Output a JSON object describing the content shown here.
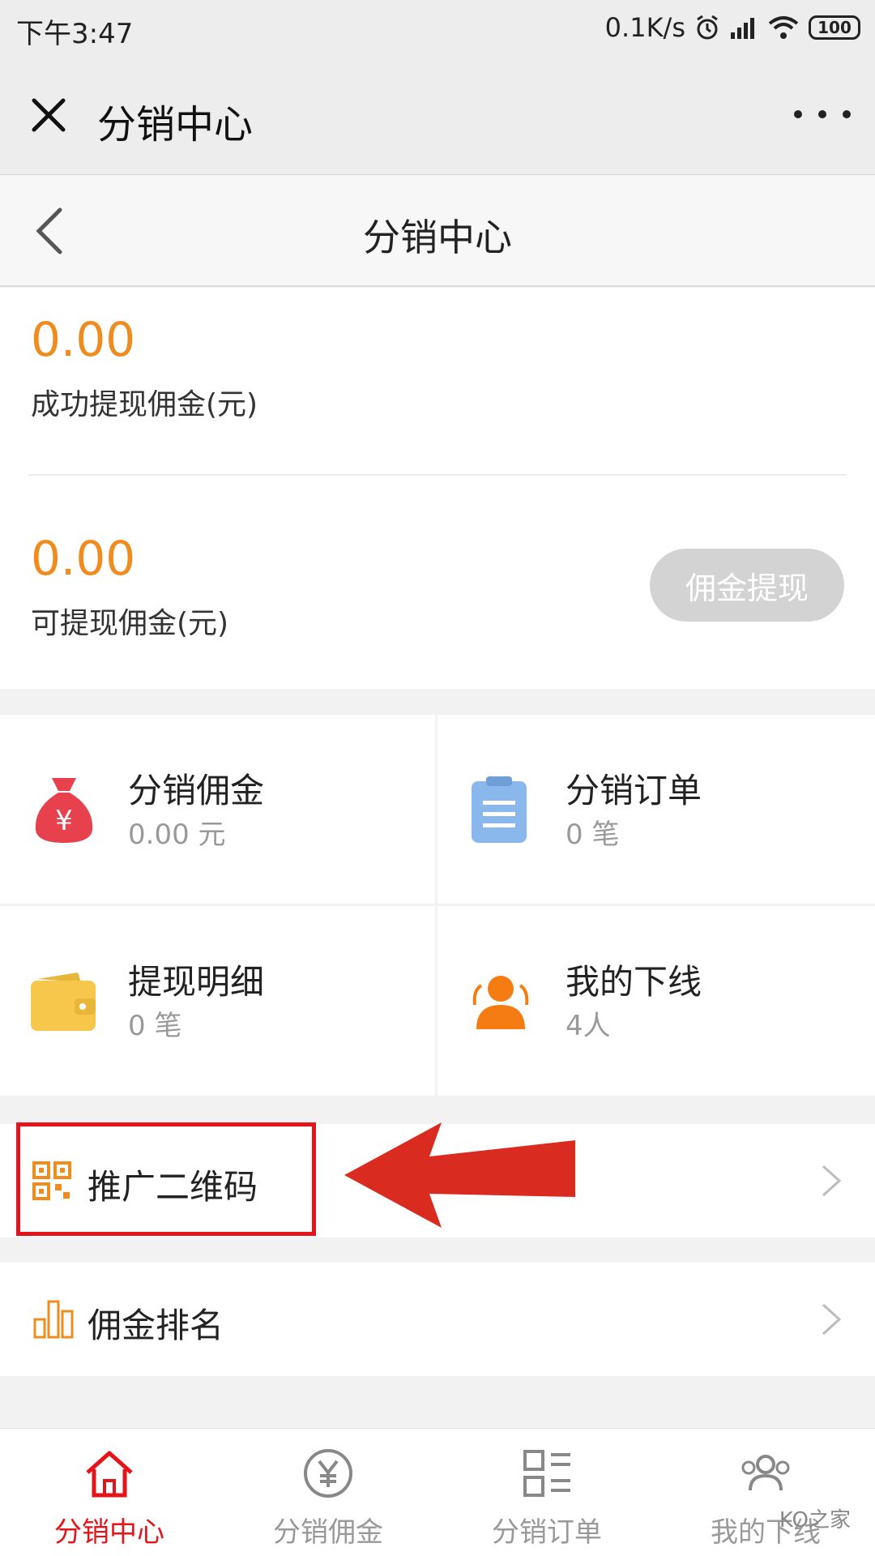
{
  "status_bar": {
    "time": "下午3:47",
    "speed": "0.1K/s",
    "battery": "100"
  },
  "wechat_bar": {
    "title": "分销中心"
  },
  "header": {
    "title": "分销中心"
  },
  "balance": {
    "success_amount": "0.00",
    "success_label": "成功提现佣金(元)",
    "available_amount": "0.00",
    "available_label": "可提现佣金(元)",
    "withdraw_button": "佣金提现"
  },
  "grid": [
    {
      "title": "分销佣金",
      "sub": "0.00 元",
      "icon": "money-bag-icon",
      "color": "#e8414e"
    },
    {
      "title": "分销订单",
      "sub": "0 笔",
      "icon": "clipboard-icon",
      "color": "#8ab8ec"
    },
    {
      "title": "提现明细",
      "sub": "0 笔",
      "icon": "wallet-icon",
      "color": "#f6c74a"
    },
    {
      "title": "我的下线",
      "sub": "4人",
      "icon": "users-icon",
      "color": "#f57c13"
    }
  ],
  "list": [
    {
      "label": "推广二维码",
      "icon": "qr-code-icon",
      "color": "#f08c1e"
    },
    {
      "label": "佣金排名",
      "icon": "bar-chart-icon",
      "color": "#f08c1e"
    }
  ],
  "bottom_nav": [
    {
      "label": "分销中心",
      "icon": "home-icon",
      "active": true
    },
    {
      "label": "分销佣金",
      "icon": "yen-circle-icon",
      "active": false
    },
    {
      "label": "分销订单",
      "icon": "order-list-icon",
      "active": false
    },
    {
      "label": "我的下线",
      "icon": "team-icon",
      "active": false
    }
  ],
  "watermark": "KO之家",
  "colors": {
    "accent_orange": "#f08c1e",
    "active_red": "#e5141b",
    "annotation_red": "#e5141b"
  }
}
